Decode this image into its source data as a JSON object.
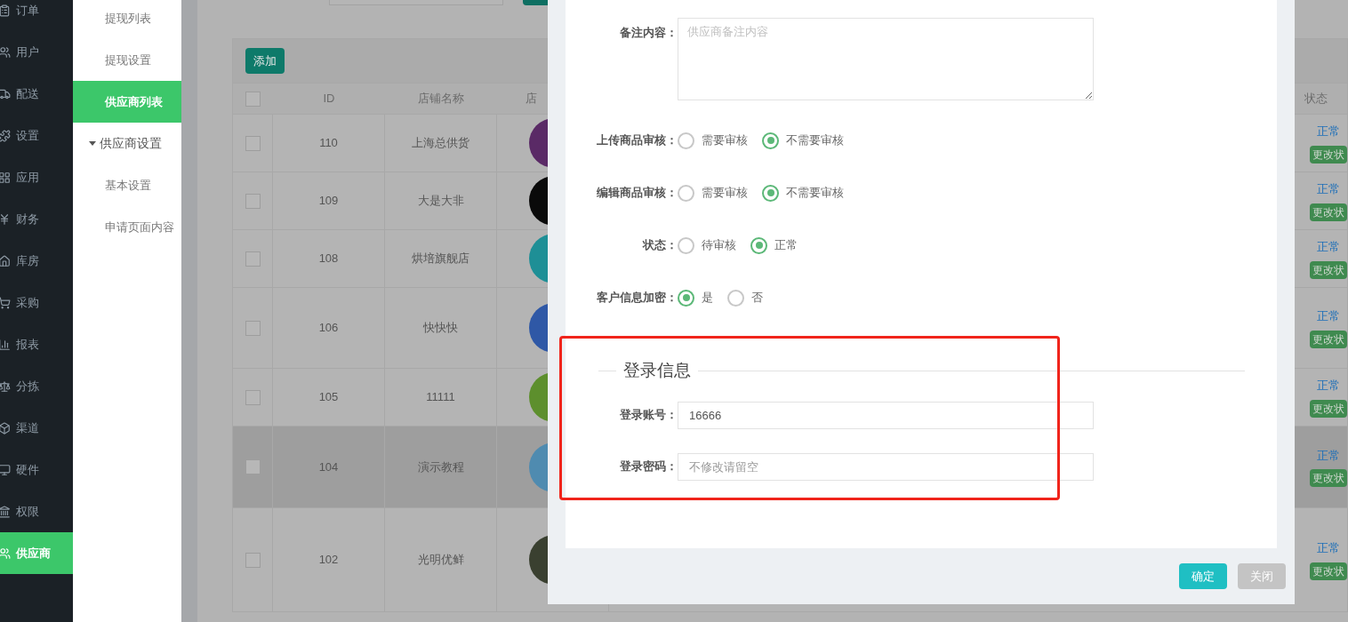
{
  "nav": {
    "items": [
      {
        "label": "订单",
        "selected": false
      },
      {
        "label": "用户",
        "selected": false
      },
      {
        "label": "配送",
        "selected": false
      },
      {
        "label": "设置",
        "selected": false
      },
      {
        "label": "应用",
        "selected": false
      },
      {
        "label": "财务",
        "selected": false
      },
      {
        "label": "库房",
        "selected": false
      },
      {
        "label": "采购",
        "selected": false
      },
      {
        "label": "报表",
        "selected": false
      },
      {
        "label": "分拣",
        "selected": false
      },
      {
        "label": "渠道",
        "selected": false
      },
      {
        "label": "硬件",
        "selected": false
      },
      {
        "label": "权限",
        "selected": false
      },
      {
        "label": "供应商",
        "selected": true
      }
    ]
  },
  "subnav": {
    "items": [
      {
        "kind": "link",
        "label": "提现列表",
        "selected": false
      },
      {
        "kind": "link",
        "label": "提现设置",
        "selected": false
      },
      {
        "kind": "link",
        "label": "供应商列表",
        "selected": true
      },
      {
        "kind": "group",
        "label": "供应商设置",
        "expanded": true,
        "children": [
          {
            "kind": "link",
            "label": "基本设置",
            "selected": false
          },
          {
            "kind": "link",
            "label": "申请页面内容",
            "selected": false
          }
        ]
      }
    ]
  },
  "table": {
    "add_button": "添加",
    "header_checked": false,
    "columns": [
      "ID",
      "店铺名称",
      "店"
    ],
    "status_column": "状态",
    "rows": [
      {
        "id": "110",
        "name": "上海总供货",
        "checked": false,
        "highlighted": false,
        "status": "正常",
        "action": "更改状"
      },
      {
        "id": "109",
        "name": "大是大非",
        "checked": false,
        "highlighted": false,
        "status": "正常",
        "action": "更改状"
      },
      {
        "id": "108",
        "name": "烘培旗舰店",
        "checked": false,
        "highlighted": false,
        "status": "正常",
        "action": "更改状"
      },
      {
        "id": "106",
        "name": "快快快",
        "checked": false,
        "highlighted": false,
        "status": "正常",
        "action": "更改状"
      },
      {
        "id": "105",
        "name": "11111",
        "checked": false,
        "highlighted": false,
        "status": "正常",
        "action": "更改状"
      },
      {
        "id": "104",
        "name": "演示教程",
        "checked": false,
        "highlighted": true,
        "status": "正常",
        "action": "更改状"
      },
      {
        "id": "102",
        "name": "光明优鲜",
        "checked": false,
        "highlighted": false,
        "status": "正常",
        "action": "更改状"
      }
    ]
  },
  "modal": {
    "remark": {
      "label": "备注内容：",
      "placeholder": "供应商备注内容"
    },
    "radio_groups": [
      {
        "label": "上传商品审核：",
        "options": [
          {
            "label": "需要审核",
            "selected": false
          },
          {
            "label": "不需要审核",
            "selected": true
          }
        ]
      },
      {
        "label": "编辑商品审核：",
        "options": [
          {
            "label": "需要审核",
            "selected": false
          },
          {
            "label": "不需要审核",
            "selected": true
          }
        ]
      },
      {
        "label": "状态：",
        "options": [
          {
            "label": "待审核",
            "selected": false
          },
          {
            "label": "正常",
            "selected": true
          }
        ]
      },
      {
        "label": "客户信息加密：",
        "options": [
          {
            "label": "是",
            "selected": true
          },
          {
            "label": "否",
            "selected": false
          }
        ]
      }
    ],
    "login_section": {
      "title": "登录信息",
      "highlighted": true,
      "account": {
        "label": "登录账号：",
        "value": "16666"
      },
      "password": {
        "label": "登录密码：",
        "placeholder": "不修改请留空"
      }
    },
    "buttons": {
      "confirm": "确定",
      "close": "关闭"
    }
  }
}
